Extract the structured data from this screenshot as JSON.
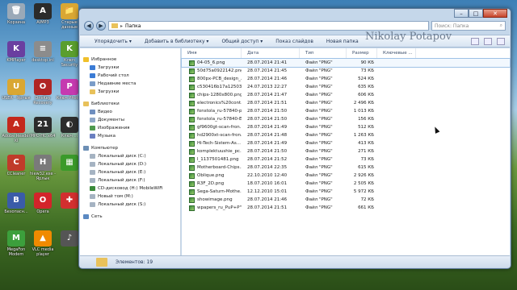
{
  "desktop_icons": [
    {
      "label": "Корзина",
      "color": "#9aa9b8",
      "glyph": "🗑"
    },
    {
      "label": "KMPlayer",
      "color": "#6a3fa0",
      "glyph": "K"
    },
    {
      "label": "USER - Ярлык",
      "color": "#d9a733",
      "glyph": "U"
    },
    {
      "label": "Adobe Reader XI",
      "color": "#c4281c",
      "glyph": "A"
    },
    {
      "label": "CCleaner",
      "color": "#c03b2a",
      "glyph": "C"
    },
    {
      "label": "Безопасн...",
      "color": "#3a5ca8",
      "glyph": "B"
    },
    {
      "label": "MegaFon Modem",
      "color": "#3c9f3c",
      "glyph": "M"
    },
    {
      "label": "AIMP3",
      "color": "#2b2b2b",
      "glyph": "A"
    },
    {
      "label": "desktop.ini",
      "color": "#8c8c8c",
      "glyph": "≡"
    },
    {
      "label": "OneKey Recovery",
      "color": "#b02424",
      "glyph": "O"
    },
    {
      "label": "MPC-HC x64",
      "color": "#2b2b2b",
      "glyph": "21"
    },
    {
      "label": "hiew32.exe - Ярлык",
      "color": "#7a7a7a",
      "glyph": "H"
    },
    {
      "label": "Opera",
      "color": "#d3242a",
      "glyph": "O"
    },
    {
      "label": "VLC media player",
      "color": "#f08a00",
      "glyph": "▲"
    },
    {
      "label": "Старые данные",
      "color": "#d9a733",
      "glyph": "📁"
    },
    {
      "label": "Ключ Security",
      "color": "#5a9e2e",
      "glyph": "K"
    },
    {
      "label": "Ключ Photos",
      "color": "#c53ab0",
      "glyph": "P"
    },
    {
      "label": "Ключ ...",
      "color": "#2d2d2d",
      "glyph": "◐"
    },
    {
      "label": "",
      "color": "#3a9a2a",
      "glyph": "▦"
    },
    {
      "label": "",
      "color": "#d22f2f",
      "glyph": "✚"
    },
    {
      "label": "",
      "color": "#555",
      "glyph": "♪"
    }
  ],
  "window": {
    "controls": {
      "minimize": "–",
      "maximize": "□",
      "close": "✕"
    },
    "address": {
      "path_root": "▸",
      "path": "Папка"
    },
    "search_placeholder": "Поиск: Папка",
    "toolbar": [
      "Упорядочить ▾",
      "Добавить в библиотеку ▾",
      "Общий доступ ▾",
      "Показ слайдов",
      "Новая папка"
    ],
    "watermark": "Nikolay Potapov"
  },
  "nav": [
    {
      "label": "Избранное",
      "head": true,
      "color": "#f0c02a"
    },
    {
      "label": "Загрузки",
      "color": "#3a7bd5"
    },
    {
      "label": "Рабочий стол",
      "color": "#3a7bd5"
    },
    {
      "label": "Недавние места",
      "color": "#7a9cc8"
    },
    {
      "label": "Загрузки",
      "color": "#e8c15a"
    },
    {
      "label": "Библиотеки",
      "head": true,
      "color": "#e8c15a"
    },
    {
      "label": "Видео",
      "color": "#6f8fbf"
    },
    {
      "label": "Документы",
      "color": "#8fa8c8"
    },
    {
      "label": "Изображения",
      "color": "#4f9a4f"
    },
    {
      "label": "Музыка",
      "color": "#6a7fc0"
    },
    {
      "label": "Компьютер",
      "head": true,
      "color": "#6d8fb5"
    },
    {
      "label": "Локальный диск (C:)",
      "color": "#a5b3c2"
    },
    {
      "label": "Локальный диск (D:)",
      "color": "#a5b3c2"
    },
    {
      "label": "Локальный диск (E:)",
      "color": "#a5b3c2"
    },
    {
      "label": "Локальный диск (F:)",
      "color": "#a5b3c2"
    },
    {
      "label": "CD-дисковод (H:) MobileWiFi",
      "color": "#3a8a3a"
    },
    {
      "label": "Новый том (M:)",
      "color": "#a5b3c2"
    },
    {
      "label": "Локальный диск (S:)",
      "color": "#a5b3c2"
    },
    {
      "label": "Сеть",
      "head": true,
      "color": "#5b89c2"
    }
  ],
  "columns": {
    "name": "Имя",
    "date": "Дата",
    "type": "Тип",
    "size": "Размер",
    "tags": "Ключевые ..."
  },
  "files": [
    {
      "name": "04-05_6.png",
      "date": "28.07.2014 21:41",
      "type": "Файл \"PNG\"",
      "size": "90 КБ"
    },
    {
      "name": "50d75a0922142.png",
      "date": "28.07.2014 21:45",
      "type": "Файл \"PNG\"",
      "size": "73 КБ"
    },
    {
      "name": "800px-PCB_design_...",
      "date": "28.07.2014 21:46",
      "type": "Файл \"PNG\"",
      "size": "524 КБ"
    },
    {
      "name": "c530416b17a12503f...",
      "date": "24.07.2013 22:27",
      "type": "Файл \"PNG\"",
      "size": "635 КБ"
    },
    {
      "name": "chips-1280x800.png",
      "date": "28.07.2014 21:47",
      "type": "Файл \"PNG\"",
      "size": "606 КБ"
    },
    {
      "name": "electronics%20cont...",
      "date": "28.07.2014 21:51",
      "type": "Файл \"PNG\"",
      "size": "2 496 КБ"
    },
    {
      "name": "fonstola_ru-57840-p...",
      "date": "28.07.2014 21:50",
      "type": "Файл \"PNG\"",
      "size": "1 013 КБ"
    },
    {
      "name": "fonstola_ru-57840-E...",
      "date": "28.07.2014 21:50",
      "type": "Файл \"PNG\"",
      "size": "156 КБ"
    },
    {
      "name": "gf9600gt-scan-fron...",
      "date": "28.07.2014 21:49",
      "type": "Файл \"PNG\"",
      "size": "512 КБ"
    },
    {
      "name": "hd2900xt-scan-fron...",
      "date": "28.07.2014 21:48",
      "type": "Файл \"PNG\"",
      "size": "1 263 КБ"
    },
    {
      "name": "Hi-Tech-Sistem-As...",
      "date": "28.07.2014 21:49",
      "type": "Файл \"PNG\"",
      "size": "413 КБ"
    },
    {
      "name": "komplektuushie_pc...",
      "date": "28.07.2014 21:50",
      "type": "Файл \"PNG\"",
      "size": "271 КБ"
    },
    {
      "name": "l_1137501481.png",
      "date": "28.07.2014 21:52",
      "type": "Файл \"PNG\"",
      "size": "73 КБ"
    },
    {
      "name": "Motherboard-Chips...",
      "date": "28.07.2014 22:35",
      "type": "Файл \"PNG\"",
      "size": "615 КБ"
    },
    {
      "name": "Oblique.png",
      "date": "22.10.2010 12:40",
      "type": "Файл \"PNG\"",
      "size": "2 926 КБ"
    },
    {
      "name": "R3F_2D.png",
      "date": "18.07.2010 16:01",
      "type": "Файл \"PNG\"",
      "size": "2 505 КБ"
    },
    {
      "name": "Sega-Saturn-Mothe...",
      "date": "12.12.2010 15:01",
      "type": "Файл \"PNG\"",
      "size": "5 972 КБ"
    },
    {
      "name": "showimage.png",
      "date": "28.07.2014 21:46",
      "type": "Файл \"PNG\"",
      "size": "72 КБ"
    },
    {
      "name": "wpapers_ru_PuP+P\"...",
      "date": "28.07.2014 21:51",
      "type": "Файл \"PNG\"",
      "size": "661 КБ"
    }
  ],
  "status": {
    "text": "Элементов: 19"
  }
}
